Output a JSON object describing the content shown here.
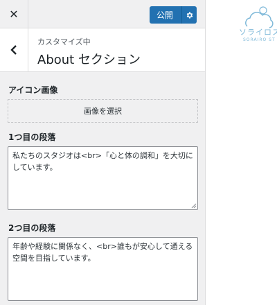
{
  "topbar": {
    "close_icon": "close-icon",
    "publish_label": "公開",
    "settings_icon": "gear-icon"
  },
  "section": {
    "breadcrumb": "カスタマイズ中",
    "title": "About セクション",
    "back_icon": "chevron-left-icon"
  },
  "controls": {
    "image_label": "アイコン画像",
    "image_button": "画像を選択",
    "para1_label": "1つ目の段落",
    "para1_value": "私たちのスタジオは<br>「心と体の調和」を大切にしています。",
    "para2_label": "2つ目の段落",
    "para2_value": "年齢や経験に関係なく、<br>誰もが安心して通える空間を目指しています。"
  },
  "preview": {
    "logo_text": "ソライロスタ",
    "logo_sub": "SORAIRO ST"
  },
  "colors": {
    "accent": "#2271b1",
    "panel_bg": "#f0f0f1",
    "logo": "#7fb9d9"
  }
}
